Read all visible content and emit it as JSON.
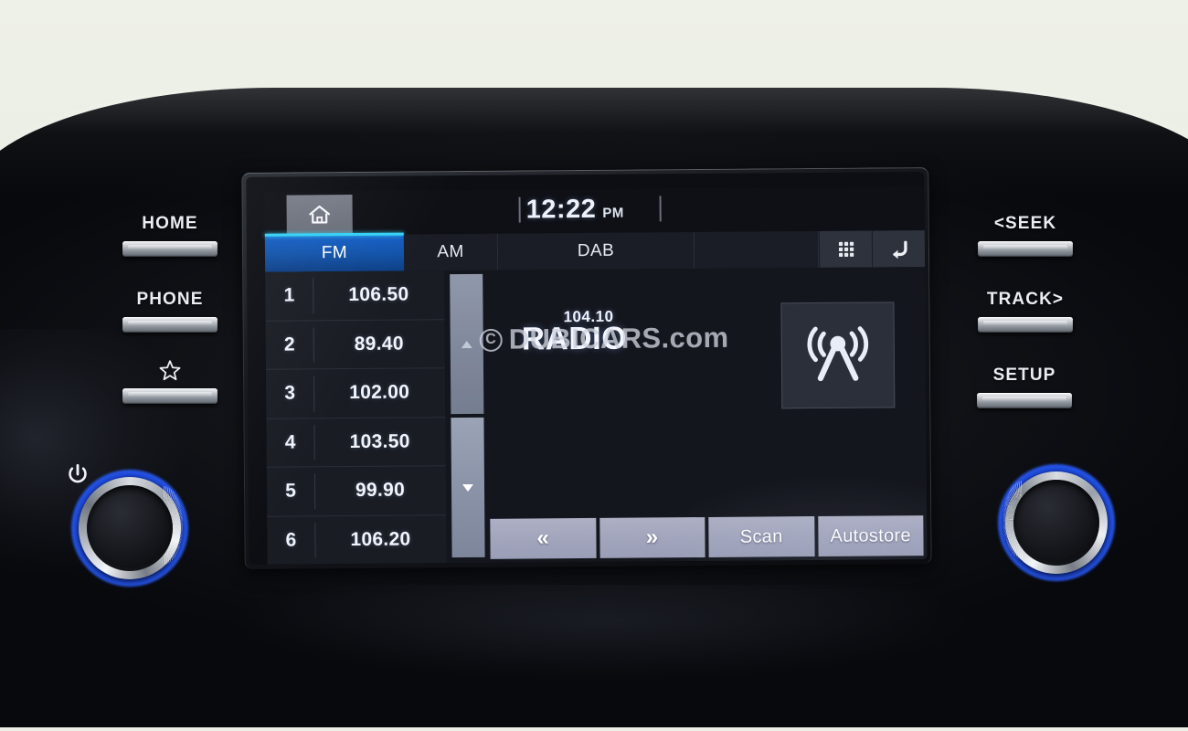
{
  "device": {
    "type": "car-infotainment-head-unit",
    "screen_mode": "radio"
  },
  "status_bar": {
    "home_icon": "home-icon",
    "clock_time": "12:22",
    "clock_ampm": "PM"
  },
  "band_tabs": [
    {
      "label": "FM",
      "active": true
    },
    {
      "label": "AM",
      "active": false
    },
    {
      "label": "DAB",
      "active": false
    }
  ],
  "band_row_icons": [
    {
      "name": "grid-keypad-icon",
      "glyph": "grid"
    },
    {
      "name": "back-return-icon",
      "glyph": "return-arrow"
    }
  ],
  "presets": [
    {
      "number": "1",
      "frequency": "106.50"
    },
    {
      "number": "2",
      "frequency": "89.40"
    },
    {
      "number": "3",
      "frequency": "102.00"
    },
    {
      "number": "4",
      "frequency": "103.50"
    },
    {
      "number": "5",
      "frequency": "99.90"
    },
    {
      "number": "6",
      "frequency": "106.20"
    }
  ],
  "scroll": {
    "up_icon": "triangle-up-icon",
    "down_icon": "triangle-down-icon"
  },
  "now_playing": {
    "frequency": "104.10",
    "source_label": "RADIO",
    "antenna_icon": "broadcast-antenna-icon"
  },
  "watermark": {
    "copyright_symbol": "C",
    "text": "DUBICARS.com"
  },
  "bottom_controls": [
    {
      "label": "«",
      "name": "seek-back-button"
    },
    {
      "label": "»",
      "name": "seek-forward-button"
    },
    {
      "label": "Scan",
      "name": "scan-button"
    },
    {
      "label": "Autostore",
      "name": "autostore-button"
    }
  ],
  "hard_keys_left": [
    {
      "label": "HOME",
      "name": "home-hardkey"
    },
    {
      "label": "PHONE",
      "name": "phone-hardkey"
    },
    {
      "label": "",
      "icon": "star-icon",
      "name": "favorites-hardkey"
    }
  ],
  "hard_keys_right": [
    {
      "label": "<SEEK",
      "name": "seek-hardkey"
    },
    {
      "label": "TRACK>",
      "name": "track-hardkey"
    },
    {
      "label": "SETUP",
      "name": "setup-hardkey"
    }
  ],
  "knobs": {
    "left": {
      "name": "power-volume-knob",
      "icon": "power-icon",
      "ring_color": "#2a5cf0"
    },
    "right": {
      "name": "tune-knob",
      "ring_color": "#2a5cf0"
    }
  },
  "colors": {
    "accent_tab": "#1560c8",
    "accent_tab_edge": "#35d2f5",
    "screen_bg": "#14161d",
    "knob_ring": "#2a5cf0",
    "button_face": "#a3a6bd"
  }
}
